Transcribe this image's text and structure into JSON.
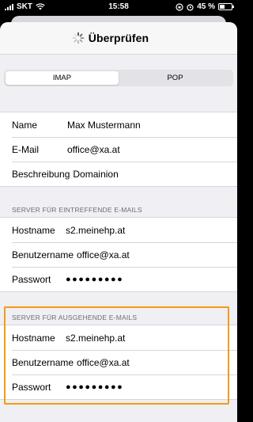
{
  "status_bar": {
    "carrier": "SKT",
    "time": "15:58",
    "battery": "45 %",
    "battery_level": 0.45
  },
  "nav": {
    "title": "Überprüfen",
    "spinner_icon": "activity-spinner-icon"
  },
  "segment": {
    "options": [
      "IMAP",
      "POP"
    ],
    "selected": "IMAP"
  },
  "account": {
    "name_label": "Name",
    "name_value": "Max Mustermann",
    "email_label": "E-Mail",
    "email_value": "office@xa.at",
    "description_label": "Beschreibung",
    "description_value": "Domainion"
  },
  "incoming": {
    "header": "SERVER FÜR EINTREFFENDE E-MAILS",
    "hostname_label": "Hostname",
    "hostname_value": "s2.meinehp.at",
    "username_label": "Benutzername",
    "username_value": "office@xa.at",
    "password_label": "Passwort",
    "password_value": "●●●●●●●●●"
  },
  "outgoing": {
    "header": "SERVER FÜR AUSGEHENDE E-MAILS",
    "hostname_label": "Hostname",
    "hostname_value": "s2.meinehp.at",
    "username_label": "Benutzername",
    "username_value": "office@xa.at",
    "password_label": "Passwort",
    "password_value": "●●●●●●●●●"
  },
  "colors": {
    "highlight": "#f39c12",
    "background": "#efeff4"
  }
}
